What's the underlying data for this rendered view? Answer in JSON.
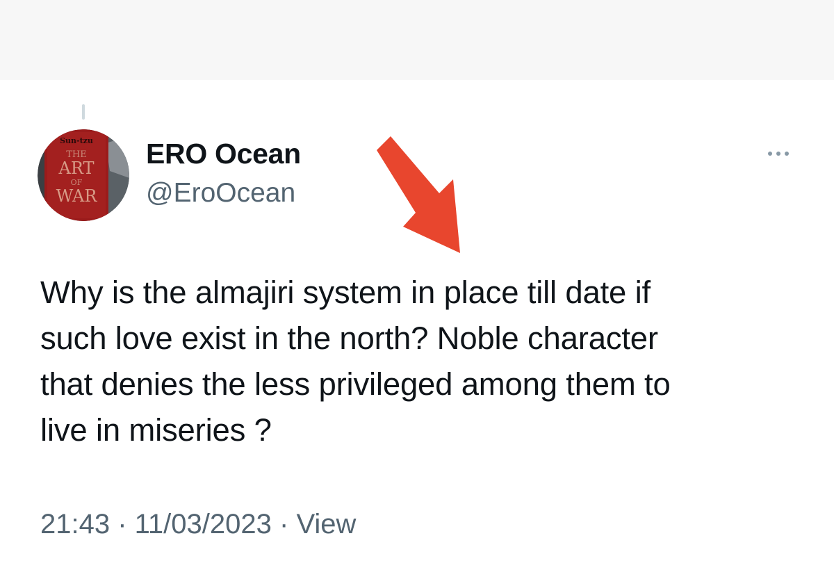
{
  "author": {
    "display_name": "ERO Ocean",
    "handle": "@EroOcean",
    "avatar_text": {
      "top": "Sun-tzu",
      "line1": "THE",
      "line2": "ART",
      "line3": "OF",
      "line4": "WAR"
    }
  },
  "tweet": {
    "text_lines": [
      "Why is the almajiri system in place till date if",
      "such love exist in the north? Noble character",
      "that denies the less privileged among them to",
      "live in miseries ?"
    ]
  },
  "meta": {
    "time": "21:43",
    "separator": " · ",
    "date": "11/03/2023",
    "views": "View"
  },
  "icons": {
    "more": "more-horizontal-icon",
    "annotation": "red-arrow-annotation"
  },
  "colors": {
    "text_primary": "#0f1419",
    "text_secondary": "#536471",
    "arrow": "#e8462e",
    "top_bar": "#f7f7f7"
  }
}
